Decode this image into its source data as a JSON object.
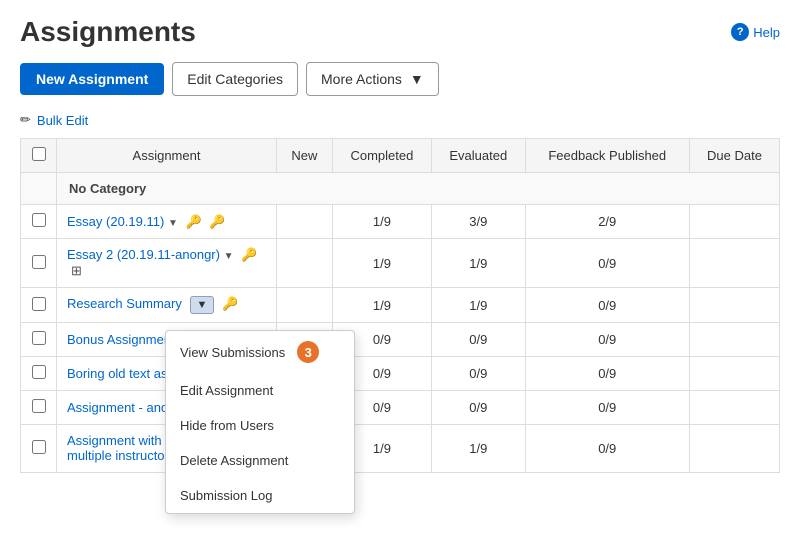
{
  "page": {
    "title": "Assignments",
    "help_label": "Help"
  },
  "toolbar": {
    "new_assignment": "New Assignment",
    "edit_categories": "Edit Categories",
    "more_actions": "More Actions"
  },
  "bulk_edit": {
    "label": "Bulk Edit"
  },
  "table": {
    "headers": {
      "select": "",
      "assignment": "Assignment",
      "new": "New",
      "completed": "Completed",
      "evaluated": "Evaluated",
      "feedback_published": "Feedback Published",
      "due_date": "Due Date"
    },
    "category_row": "No Category",
    "rows": [
      {
        "id": "row-1",
        "name": "Essay (20.19.11)",
        "new": "",
        "completed": "1/9",
        "evaluated": "3/9",
        "feedback_published": "2/9",
        "due_date": "",
        "has_dropdown": true,
        "icons": [
          "key",
          "key"
        ]
      },
      {
        "id": "row-2",
        "name": "Essay 2 (20.19.11-anongr)",
        "new": "",
        "completed": "1/9",
        "evaluated": "1/9",
        "feedback_published": "0/9",
        "due_date": "",
        "has_dropdown": true,
        "icons": [
          "key",
          "grid"
        ]
      },
      {
        "id": "row-3",
        "name": "Research Summary",
        "new": "",
        "completed": "1/9",
        "evaluated": "1/9",
        "feedback_published": "0/9",
        "due_date": "",
        "has_dropdown": true,
        "dropdown_open": true,
        "icons": [
          "key"
        ]
      },
      {
        "id": "row-4",
        "name": "Bonus Assignment (",
        "new": "",
        "completed": "0/9",
        "evaluated": "0/9",
        "feedback_published": "0/9",
        "due_date": "",
        "has_dropdown": false,
        "icons": []
      },
      {
        "id": "row-5",
        "name": "Boring old text assig",
        "new": "",
        "completed": "0/9",
        "evaluated": "0/9",
        "feedback_published": "0/9",
        "due_date": "",
        "has_dropdown": false,
        "icons": []
      },
      {
        "id": "row-6",
        "name": "Assignment - anony",
        "new": "",
        "completed": "0/9",
        "evaluated": "0/9",
        "feedback_published": "0/9",
        "due_date": "",
        "has_dropdown": false,
        "icons": []
      },
      {
        "id": "row-7",
        "name": "Assignment with an\nmultiple instructors",
        "new": "",
        "completed": "1/9",
        "evaluated": "1/9",
        "feedback_published": "0/9",
        "due_date": "",
        "has_dropdown": true,
        "icons": [
          "key"
        ]
      }
    ]
  },
  "dropdown_menu": {
    "items": [
      {
        "id": "view-submissions",
        "label": "View Submissions",
        "badge": "3"
      },
      {
        "id": "edit-assignment",
        "label": "Edit Assignment"
      },
      {
        "id": "hide-from-users",
        "label": "Hide from Users"
      },
      {
        "id": "delete-assignment",
        "label": "Delete Assignment"
      },
      {
        "id": "submission-log",
        "label": "Submission Log"
      }
    ]
  }
}
